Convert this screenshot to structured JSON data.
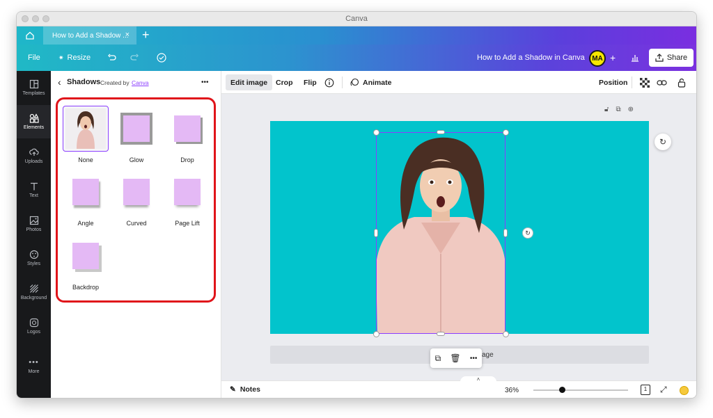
{
  "window": {
    "title": "Canva"
  },
  "tabs": {
    "active_label": "How to Add a Shadow ...",
    "close": "×",
    "add": "+"
  },
  "toolbar": {
    "file": "File",
    "resize": "Resize",
    "doc_title": "How to Add a Shadow in Canva",
    "avatar": "MA",
    "plus": "+",
    "share": "Share"
  },
  "sidebar": {
    "items": [
      {
        "label": "Templates",
        "icon": "templates-icon"
      },
      {
        "label": "Elements",
        "icon": "elements-icon"
      },
      {
        "label": "Uploads",
        "icon": "uploads-icon"
      },
      {
        "label": "Text",
        "icon": "text-icon"
      },
      {
        "label": "Photos",
        "icon": "photos-icon"
      },
      {
        "label": "Styles",
        "icon": "styles-icon"
      },
      {
        "label": "Background",
        "icon": "background-icon"
      },
      {
        "label": "Logos",
        "icon": "logos-icon"
      },
      {
        "label": "More",
        "icon": "more-icon"
      }
    ]
  },
  "panel": {
    "title": "Shadows",
    "created_by": "Created by",
    "creator_link": "Canva",
    "menu": "•••",
    "options": [
      {
        "label": "None"
      },
      {
        "label": "Glow"
      },
      {
        "label": "Drop"
      },
      {
        "label": "Angle"
      },
      {
        "label": "Curved"
      },
      {
        "label": "Page Lift"
      },
      {
        "label": "Backdrop"
      }
    ],
    "highlight_color": "#e0141a",
    "swatch_color": "#e4b9f5"
  },
  "context_bar": {
    "edit_image": "Edit image",
    "crop": "Crop",
    "flip": "Flip",
    "animate": "Animate",
    "position": "Position"
  },
  "canvas": {
    "background": "#02c4cc",
    "page_text": "age"
  },
  "footer": {
    "notes": "Notes",
    "zoom": "36%",
    "zoom_fraction": 0.36,
    "page_number": "1"
  }
}
